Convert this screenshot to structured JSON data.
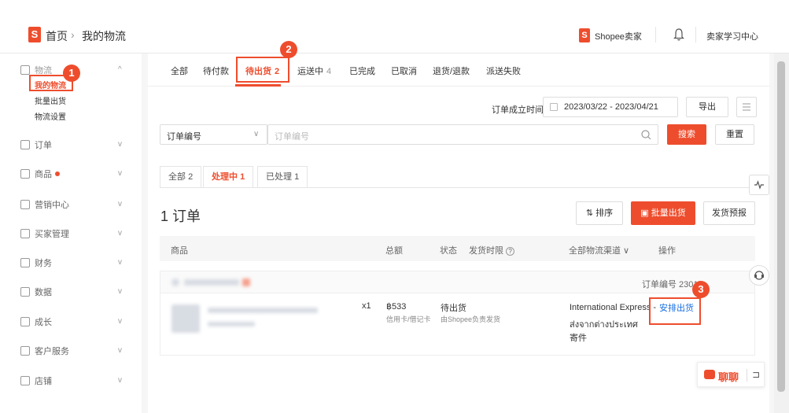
{
  "header": {
    "logo_char": "S",
    "home": "首页",
    "separator": "›",
    "current": "我的物流",
    "seller_logo_char": "S",
    "seller": "Shopee卖家",
    "learning_center": "卖家学习中心"
  },
  "sidebar": {
    "groups": [
      {
        "label": "物流",
        "chevron": "^"
      },
      {
        "label": "订单",
        "chevron": "v"
      },
      {
        "label": "商品",
        "chevron": "v"
      },
      {
        "label": "营销中心",
        "chevron": "v"
      },
      {
        "label": "买家管理",
        "chevron": "v"
      },
      {
        "label": "财务",
        "chevron": "v"
      },
      {
        "label": "数据",
        "chevron": "v"
      },
      {
        "label": "成长",
        "chevron": "v"
      },
      {
        "label": "客户服务",
        "chevron": "v"
      },
      {
        "label": "店铺",
        "chevron": "v"
      }
    ],
    "logistics_items": [
      "我的物流",
      "批量出货",
      "物流设置"
    ]
  },
  "tabs": [
    {
      "label": "全部",
      "count": ""
    },
    {
      "label": "待付款",
      "count": ""
    },
    {
      "label": "待出货",
      "count": "2"
    },
    {
      "label": "运送中",
      "count": "4"
    },
    {
      "label": "已完成",
      "count": ""
    },
    {
      "label": "已取消",
      "count": ""
    },
    {
      "label": "退货/退款",
      "count": ""
    },
    {
      "label": "派送失败",
      "count": ""
    }
  ],
  "filters": {
    "date_label": "订单成立时间",
    "date_range": "2023/03/22 - 2023/04/21",
    "export": "导出",
    "search_type": "订单编号",
    "search_placeholder": "订单编号",
    "search_button": "搜索",
    "reset_button": "重置"
  },
  "subtabs": [
    {
      "label": "全部",
      "count": "2"
    },
    {
      "label": "处理中",
      "count": "1"
    },
    {
      "label": "已处理",
      "count": "1"
    }
  ],
  "list": {
    "title": "1 订单",
    "sort": "排序",
    "bulk_ship": "批量出货",
    "ship_forecast": "发货预报",
    "columns": [
      "商品",
      "总额",
      "状态",
      "发货时限",
      "全部物流渠道 ∨",
      "操作"
    ]
  },
  "order": {
    "order_no": "订单编号 2301",
    "qty": "x1",
    "amount": "฿533",
    "payment": "信用卡/借记卡",
    "status": "待出货",
    "status_note": "由Shopee负责发货",
    "channel_line1": "International Express -",
    "channel_line2": "ส่งจากต่างประเทศ",
    "channel_line3": "寄件",
    "action": "安排出货"
  },
  "annotations": [
    "1",
    "2",
    "3"
  ],
  "chat": {
    "label": "聊聊"
  },
  "colors": {
    "accent": "#ee4d2d",
    "link": "#1a6fe0"
  }
}
